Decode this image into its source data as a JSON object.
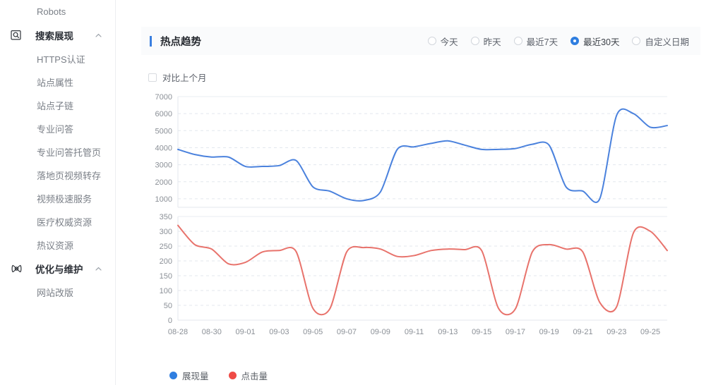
{
  "sidebar": {
    "items": [
      {
        "label": "Robots",
        "type": "leaf",
        "icon": null
      },
      {
        "label": "搜索展现",
        "type": "group",
        "icon": "search-box-icon",
        "expanded": true
      },
      {
        "label": "HTTPS认证",
        "type": "leaf",
        "icon": null
      },
      {
        "label": "站点属性",
        "type": "leaf",
        "icon": null
      },
      {
        "label": "站点子链",
        "type": "leaf",
        "icon": null
      },
      {
        "label": "专业问答",
        "type": "leaf",
        "icon": null
      },
      {
        "label": "专业问答托管页",
        "type": "leaf",
        "icon": null
      },
      {
        "label": "落地页视频转存",
        "type": "leaf",
        "icon": null
      },
      {
        "label": "视频极速服务",
        "type": "leaf",
        "icon": null
      },
      {
        "label": "医疗权威资源",
        "type": "leaf",
        "icon": null
      },
      {
        "label": "热议资源",
        "type": "leaf",
        "icon": null
      },
      {
        "label": "优化与维护",
        "type": "group",
        "icon": "atom-icon",
        "expanded": true
      },
      {
        "label": "网站改版",
        "type": "leaf",
        "icon": null
      }
    ]
  },
  "card": {
    "title": "热点趋势",
    "accent_color": "#3a7fe0",
    "range_options": [
      {
        "label": "今天",
        "selected": false
      },
      {
        "label": "昨天",
        "selected": false
      },
      {
        "label": "最近7天",
        "selected": false
      },
      {
        "label": "最近30天",
        "selected": true
      },
      {
        "label": "自定义日期",
        "selected": false
      }
    ],
    "compare": {
      "label": "对比上个月",
      "checked": false
    }
  },
  "chart_data": [
    {
      "type": "line",
      "title": "展现量",
      "name": "展现量",
      "color": "#4b82dd",
      "xlabel": "",
      "ylabel": "",
      "grid": true,
      "ylim": [
        500,
        7000
      ],
      "yticks": [
        1000,
        2000,
        3000,
        4000,
        5000,
        6000,
        7000
      ],
      "tick_labels": [
        "08-28",
        "08-30",
        "09-01",
        "09-03",
        "09-05",
        "09-07",
        "09-09",
        "09-11",
        "09-13",
        "09-15",
        "09-17",
        "09-19",
        "09-21",
        "09-23",
        "09-25"
      ],
      "x": [
        "08-28",
        "08-29",
        "08-30",
        "08-31",
        "09-01",
        "09-02",
        "09-03",
        "09-04",
        "09-05",
        "09-06",
        "09-07",
        "09-08",
        "09-09",
        "09-10",
        "09-11",
        "09-12",
        "09-13",
        "09-14",
        "09-15",
        "09-16",
        "09-17",
        "09-18",
        "09-19",
        "09-20",
        "09-21",
        "09-22",
        "09-23",
        "09-24",
        "09-25",
        "09-26"
      ],
      "values": [
        3900,
        3600,
        3450,
        3450,
        2900,
        2900,
        2950,
        3250,
        1700,
        1450,
        1000,
        900,
        1400,
        3900,
        4050,
        4250,
        4400,
        4150,
        3900,
        3900,
        3950,
        4200,
        4150,
        1700,
        1450,
        1000,
        5900,
        6000,
        5200,
        5300
      ]
    },
    {
      "type": "line",
      "title": "点击量",
      "name": "点击量",
      "color": "#e8736c",
      "xlabel": "",
      "ylabel": "",
      "grid": true,
      "ylim": [
        0,
        350
      ],
      "yticks": [
        0,
        50,
        100,
        150,
        200,
        250,
        300,
        350
      ],
      "tick_labels": [
        "08-28",
        "08-30",
        "09-01",
        "09-03",
        "09-05",
        "09-07",
        "09-09",
        "09-11",
        "09-13",
        "09-15",
        "09-17",
        "09-19",
        "09-21",
        "09-23",
        "09-25"
      ],
      "x": [
        "08-28",
        "08-29",
        "08-30",
        "08-31",
        "09-01",
        "09-02",
        "09-03",
        "09-04",
        "09-05",
        "09-06",
        "09-07",
        "09-08",
        "09-09",
        "09-10",
        "09-11",
        "09-12",
        "09-13",
        "09-14",
        "09-15",
        "09-16",
        "09-17",
        "09-18",
        "09-19",
        "09-20",
        "09-21",
        "09-22",
        "09-23",
        "09-24",
        "09-25",
        "09-26"
      ],
      "values": [
        320,
        255,
        240,
        190,
        195,
        230,
        235,
        232,
        40,
        38,
        230,
        245,
        240,
        215,
        218,
        235,
        240,
        238,
        235,
        40,
        38,
        230,
        255,
        240,
        230,
        60,
        45,
        295,
        300,
        235
      ]
    }
  ],
  "legend": [
    {
      "label": "展现量",
      "color": "#2f7ee0"
    },
    {
      "label": "点击量",
      "color": "#ef4b46"
    }
  ]
}
